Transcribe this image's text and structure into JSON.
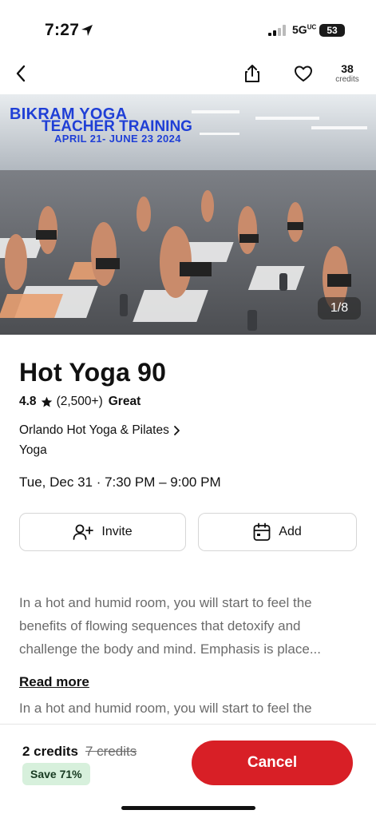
{
  "status_bar": {
    "time": "7:27",
    "network": "5G",
    "network_sup": "UC",
    "battery": "53"
  },
  "nav": {
    "credits_count": "38",
    "credits_label": "credits"
  },
  "hero": {
    "title": "BIKRAM YOGA",
    "subtitle": "TEACHER TRAINING",
    "dates": "APRIL 21- JUNE 23 2024",
    "photo_counter": "1/8"
  },
  "class": {
    "title": "Hot Yoga 90",
    "rating": "4.8",
    "review_count": "(2,500+)",
    "rating_label": "Great",
    "studio": "Orlando Hot Yoga & Pilates",
    "category": "Yoga",
    "datetime": "Tue, Dec 31 · 7:30 PM – 9:00 PM"
  },
  "actions": {
    "invite_label": "Invite",
    "add_label": "Add"
  },
  "description": {
    "text": "In a hot and humid room, you will start to feel the benefits of flowing sequences that detoxify and challenge the body and mind. Emphasis is place...",
    "read_more": "Read more",
    "repeat_line": "In a hot and humid room, you will start to feel the"
  },
  "footer": {
    "credits": "2 credits",
    "original_credits": "7 credits",
    "save_badge": "Save 71%",
    "cancel_label": "Cancel",
    "cancel_color": "#d81f26"
  },
  "icons": [
    "location-arrow-icon",
    "signal-icon",
    "battery-icon",
    "chevron-left-icon",
    "share-icon",
    "heart-icon",
    "star-icon",
    "chevron-right-icon",
    "add-person-icon",
    "calendar-icon"
  ]
}
